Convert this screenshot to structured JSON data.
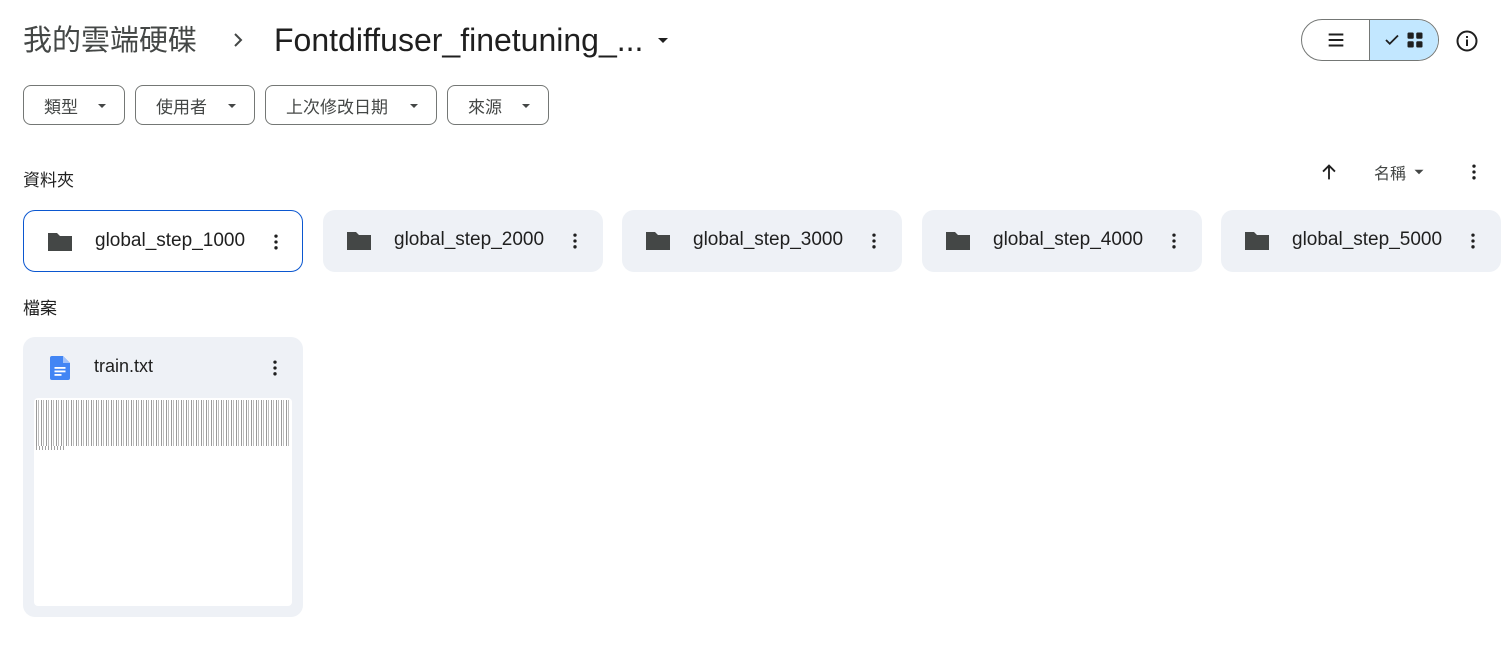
{
  "header": {
    "root_crumb": "我的雲端硬碟",
    "current_folder": "Fontdiffuser_finetuning_..."
  },
  "view_toggle": {
    "list_icon": "list-icon",
    "grid_icon": "grid-icon",
    "selected": "grid"
  },
  "filters": [
    {
      "label": "類型"
    },
    {
      "label": "使用者"
    },
    {
      "label": "上次修改日期"
    },
    {
      "label": "來源"
    }
  ],
  "folders_section": {
    "label": "資料夾",
    "sort_field": "名稱",
    "sort_direction": "ascending",
    "items": [
      {
        "name": "global_step_1000",
        "selected": true
      },
      {
        "name": "global_step_2000",
        "selected": false
      },
      {
        "name": "global_step_3000",
        "selected": false
      },
      {
        "name": "global_step_4000",
        "selected": false
      },
      {
        "name": "global_step_5000",
        "selected": false
      }
    ]
  },
  "files_section": {
    "label": "檔案",
    "items": [
      {
        "name": "train.txt",
        "icon": "doc-icon"
      }
    ]
  },
  "colors": {
    "accent": "#0b57d0",
    "toggle_selected_bg": "#c2e7ff",
    "card_bg": "#eef1f6",
    "doc_icon": "#4285f4"
  }
}
